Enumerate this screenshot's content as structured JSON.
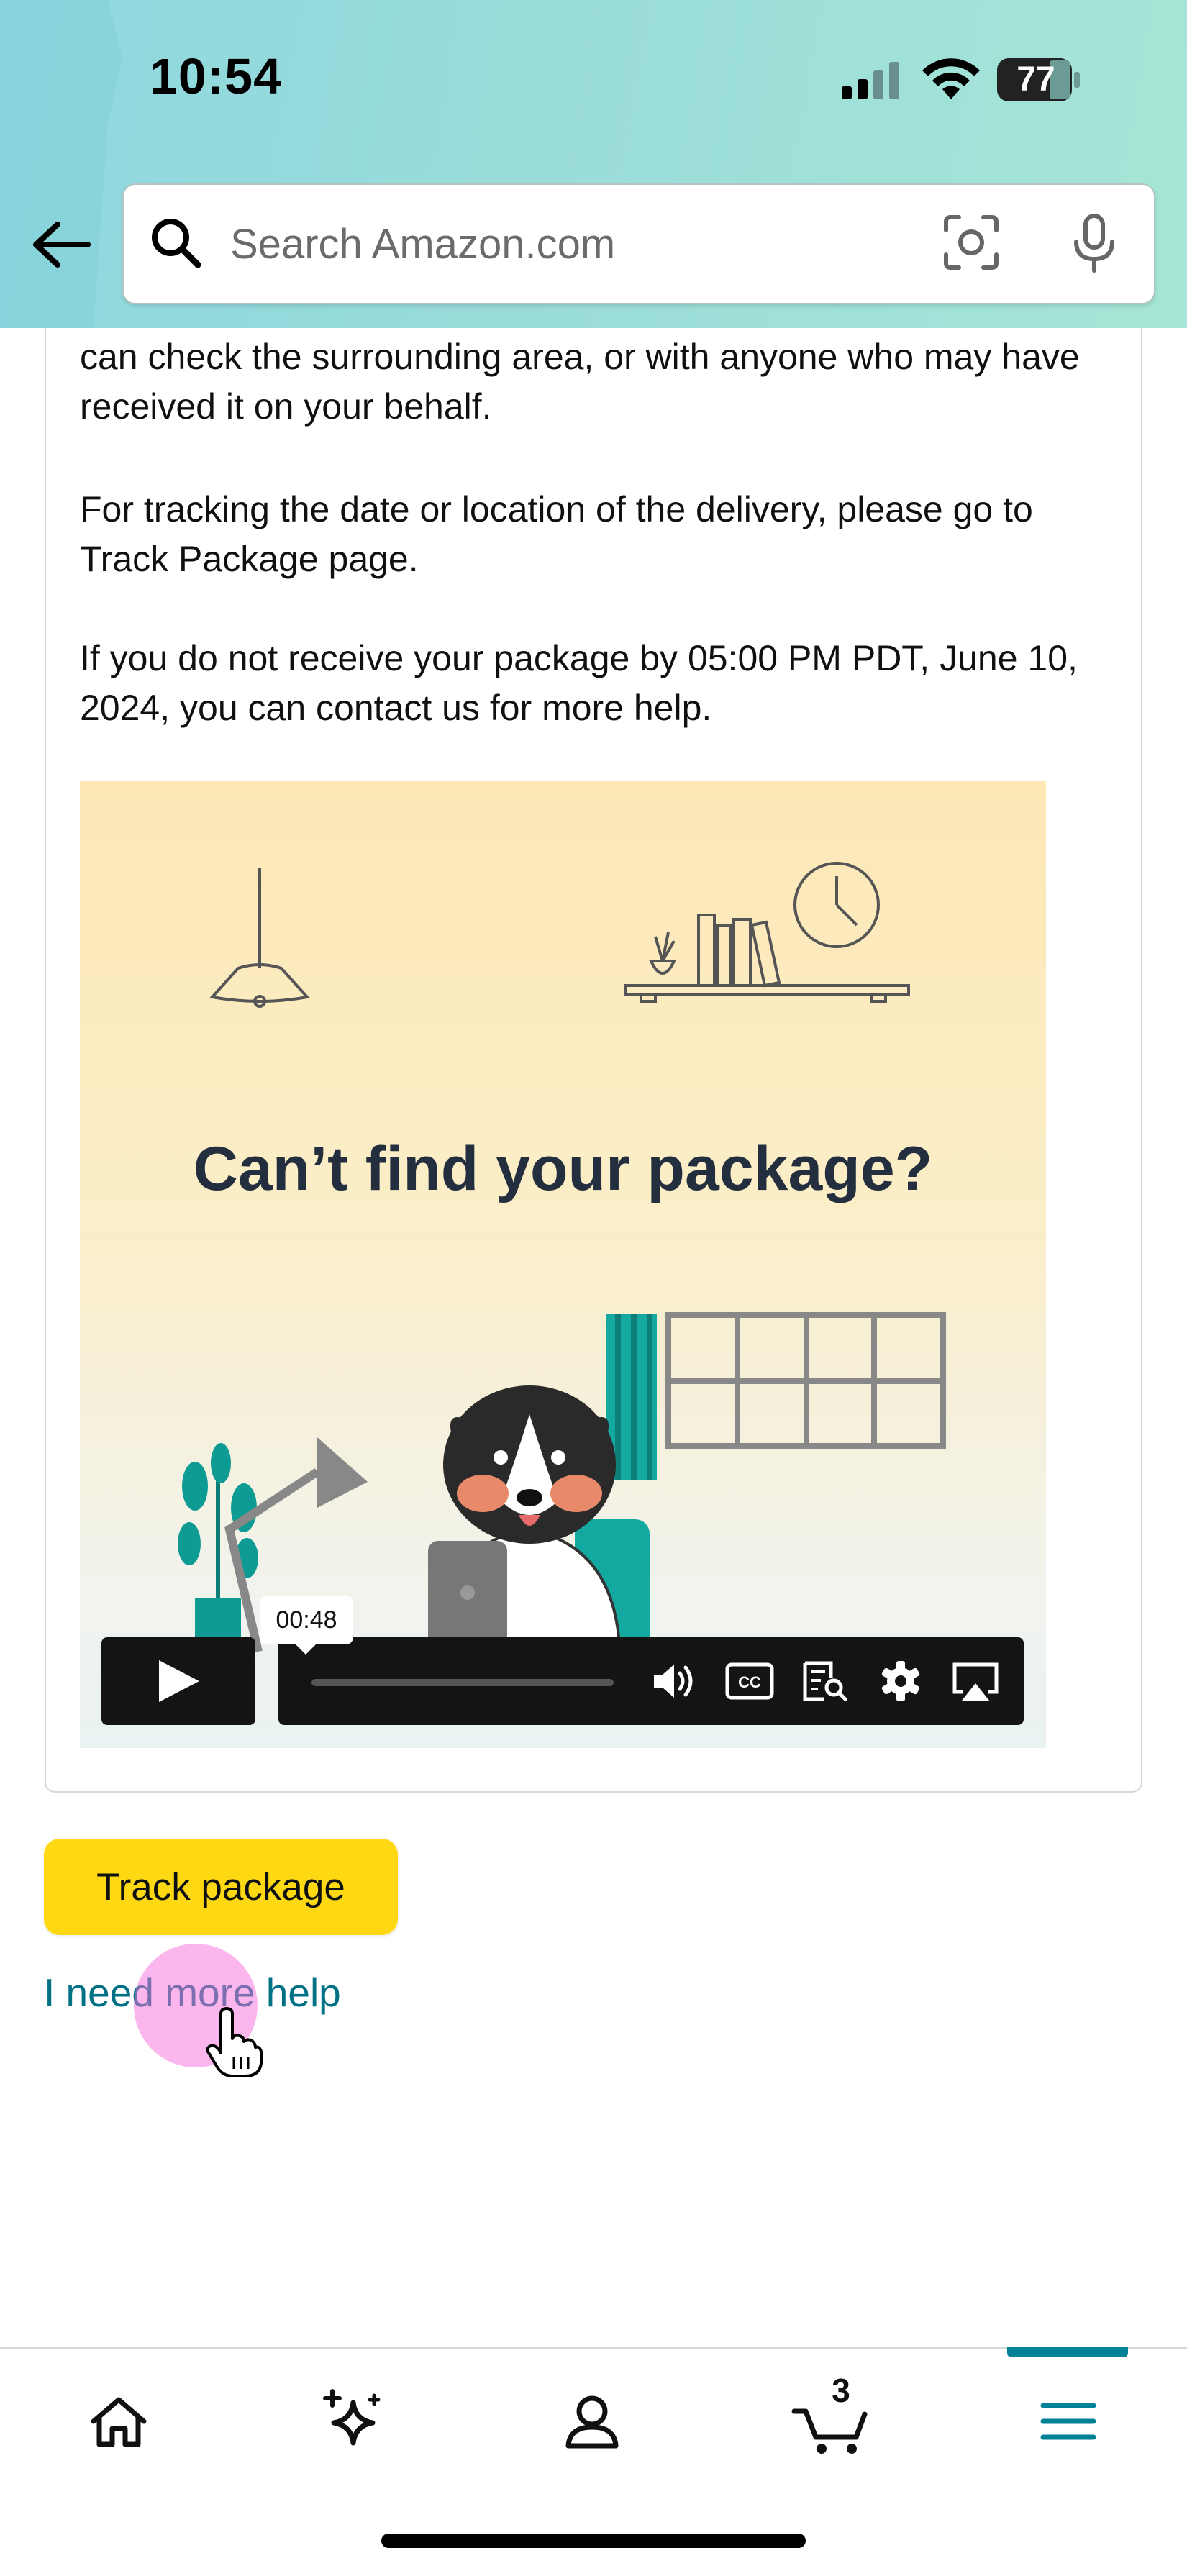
{
  "status_bar": {
    "time": "10:54",
    "battery": "77",
    "icons": [
      "cellular-signal-icon",
      "wifi-icon",
      "battery-icon"
    ]
  },
  "header": {
    "back_icon": "back-arrow-icon",
    "search_placeholder": "Search Amazon.com",
    "icons": [
      "search-icon",
      "camera-scan-icon",
      "microphone-icon"
    ],
    "gradient_colors": [
      "#8ed8df",
      "#a6e6d6"
    ]
  },
  "content": {
    "paragraphs": [
      "can check the surrounding area, or with anyone who may have received it on your behalf.",
      "For tracking the date or location of the delivery, please go to Track Package page.",
      "If you do not receive your package by 05:00 PM PDT, June 10, 2024, you can contact us for more help."
    ],
    "video": {
      "headline": "Can’t find your package?",
      "time_tooltip": "00:48",
      "controls": [
        "play-icon",
        "volume-icon",
        "closed-captions-icon",
        "transcript-icon",
        "settings-gear-icon",
        "airplay-icon"
      ]
    }
  },
  "actions": {
    "track_package_label": "Track package",
    "more_help_label": "I need more help",
    "button_color": "#ffd814",
    "link_color": "#007185"
  },
  "bottom_nav": {
    "items": [
      {
        "name": "home",
        "icon": "home-icon"
      },
      {
        "name": "rufus",
        "icon": "sparkle-icon"
      },
      {
        "name": "account",
        "icon": "person-icon"
      },
      {
        "name": "cart",
        "icon": "cart-icon",
        "count": "3"
      },
      {
        "name": "menu",
        "icon": "menu-icon",
        "active": true
      }
    ],
    "active_color": "#008296"
  }
}
